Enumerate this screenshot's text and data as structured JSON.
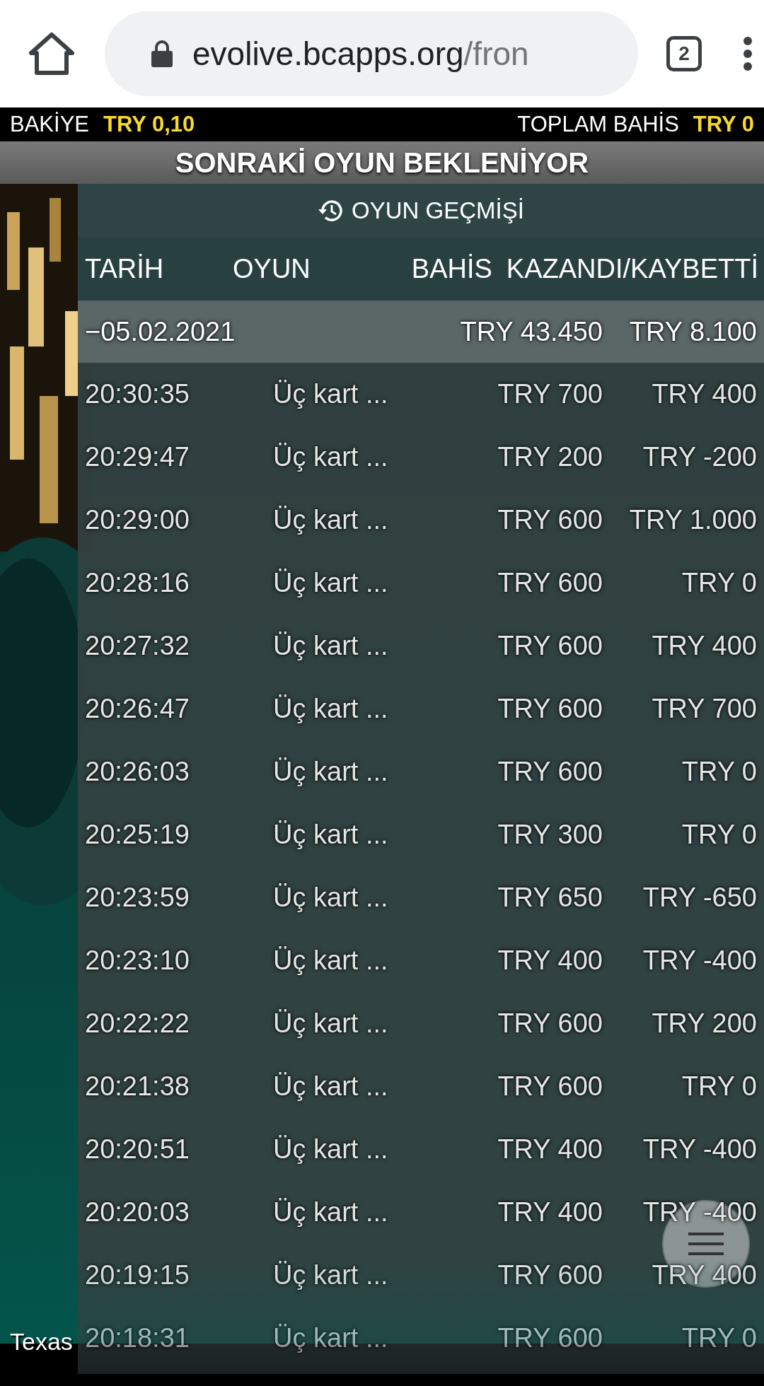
{
  "browser": {
    "url_host": "evolive.bcapps.org",
    "url_path": "/fron",
    "tab_count": "2"
  },
  "balance": {
    "label": "BAKİYE",
    "value": "TRY 0,10"
  },
  "total_bet": {
    "label": "TOPLAM BAHİS",
    "value": "TRY 0"
  },
  "status": "SONRAKİ OYUN BEKLENİYOR",
  "history": {
    "title": "OYUN GEÇMİŞİ",
    "columns": [
      "TARİH",
      "OYUN",
      "BAHİS",
      "KAZANDI/KAYBETTİ"
    ],
    "day": {
      "date": "−05.02.2021",
      "bet": "TRY 43.450",
      "result": "TRY 8.100"
    },
    "rows": [
      {
        "time": "20:30:35",
        "game": "Üç kart ...",
        "bet": "TRY 700",
        "result": "TRY 400"
      },
      {
        "time": "20:29:47",
        "game": "Üç kart ...",
        "bet": "TRY 200",
        "result": "TRY -200"
      },
      {
        "time": "20:29:00",
        "game": "Üç kart ...",
        "bet": "TRY 600",
        "result": "TRY 1.000"
      },
      {
        "time": "20:28:16",
        "game": "Üç kart ...",
        "bet": "TRY 600",
        "result": "TRY 0"
      },
      {
        "time": "20:27:32",
        "game": "Üç kart ...",
        "bet": "TRY 600",
        "result": "TRY 400"
      },
      {
        "time": "20:26:47",
        "game": "Üç kart ...",
        "bet": "TRY 600",
        "result": "TRY 700"
      },
      {
        "time": "20:26:03",
        "game": "Üç kart ...",
        "bet": "TRY 600",
        "result": "TRY 0"
      },
      {
        "time": "20:25:19",
        "game": "Üç kart ...",
        "bet": "TRY 300",
        "result": "TRY 0"
      },
      {
        "time": "20:23:59",
        "game": "Üç kart ...",
        "bet": "TRY 650",
        "result": "TRY -650"
      },
      {
        "time": "20:23:10",
        "game": "Üç kart ...",
        "bet": "TRY 400",
        "result": "TRY -400"
      },
      {
        "time": "20:22:22",
        "game": "Üç kart ...",
        "bet": "TRY 600",
        "result": "TRY 200"
      },
      {
        "time": "20:21:38",
        "game": "Üç kart ...",
        "bet": "TRY 600",
        "result": "TRY 0"
      },
      {
        "time": "20:20:51",
        "game": "Üç kart ...",
        "bet": "TRY 400",
        "result": "TRY -400"
      },
      {
        "time": "20:20:03",
        "game": "Üç kart ...",
        "bet": "TRY 400",
        "result": "TRY -400"
      },
      {
        "time": "20:19:15",
        "game": "Üç kart ...",
        "bet": "TRY 600",
        "result": "TRY 400"
      },
      {
        "time": "20:18:31",
        "game": "Üç kart ...",
        "bet": "TRY 600",
        "result": "TRY 0"
      }
    ]
  },
  "game_caption": "Texas"
}
